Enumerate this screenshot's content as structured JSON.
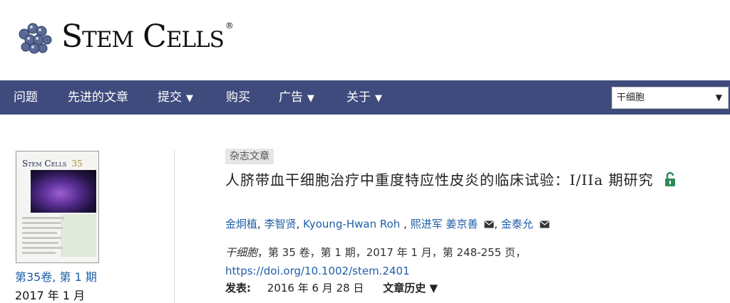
{
  "header": {
    "logo_text": "Stem Cells",
    "registered_mark": "®"
  },
  "nav": {
    "items": [
      {
        "label": "问题",
        "caret": ""
      },
      {
        "label": "先进的文章",
        "caret": ""
      },
      {
        "label": "提交",
        "caret": "▼"
      },
      {
        "label": "购买",
        "caret": ""
      },
      {
        "label": "广告",
        "caret": "▼"
      },
      {
        "label": "关于",
        "caret": "▼"
      }
    ],
    "search_scope": {
      "value": "干细胞",
      "arrow": "▼"
    }
  },
  "cover": {
    "logo": "Stem Cells",
    "issue_number": "35",
    "volume_link": "第35卷, 第 1 期",
    "date": "2017 年 1 月"
  },
  "article": {
    "type_badge": "杂志文章",
    "title": "人脐带血干细胞治疗中重度特应性皮炎的临床试验：I/IIa 期研究",
    "authors": [
      {
        "name": "金炯植",
        "sep": ", ",
        "mail": false
      },
      {
        "name": "李智贤",
        "sep": ", ",
        "mail": false
      },
      {
        "name": "Kyoung-Hwan Roh",
        "sep": " , ",
        "mail": false
      },
      {
        "name": "熙进军",
        "sep": " ",
        "mail": false
      },
      {
        "name": "姜京善",
        "sep": ", ",
        "mail": true
      },
      {
        "name": "金泰允",
        "sep": "",
        "mail": true
      }
    ],
    "citation": {
      "journal": "干细胞",
      "details": "，第 35 卷，第 1 期，2017 年 1 月，第 248-255 页，",
      "doi": "https://doi.org/10.1002/stem.2401"
    },
    "published_label": "发表:",
    "published_date": "2016 年 6 月 28 日",
    "history_label": "文章历史 ▼"
  },
  "colors": {
    "nav_bg": "#3f4b7d",
    "link": "#1f5fa8",
    "open_access": "#2e8b57"
  }
}
